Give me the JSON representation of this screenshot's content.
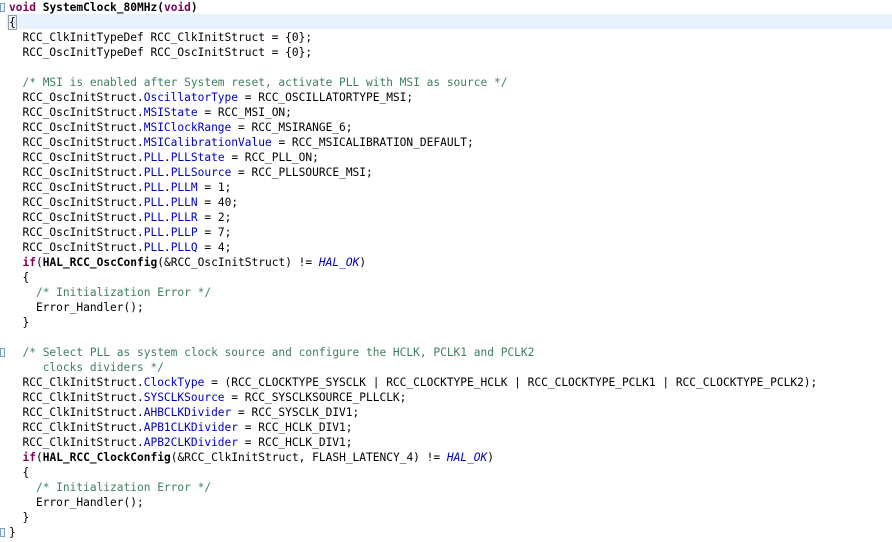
{
  "editor": {
    "lines": [
      {
        "segments": [
          {
            "t": "void",
            "c": "kw"
          },
          {
            "t": " "
          },
          {
            "t": "SystemClock_80MHz",
            "c": "fn"
          },
          {
            "t": "(",
            "c": "fn"
          },
          {
            "t": "void",
            "c": "kw"
          },
          {
            "t": ")",
            "c": "fn"
          }
        ]
      },
      {
        "segments": [
          {
            "t": "{",
            "c": "caret-brace"
          }
        ]
      },
      {
        "segments": [
          {
            "t": "  RCC_ClkInitTypeDef RCC_ClkInitStruct = {0};"
          }
        ]
      },
      {
        "segments": [
          {
            "t": "  RCC_OscInitTypeDef RCC_OscInitStruct = {0};"
          }
        ]
      },
      {
        "segments": [
          {
            "t": ""
          }
        ]
      },
      {
        "segments": [
          {
            "t": "  "
          },
          {
            "t": "/* MSI is enabled after System reset, activate PLL with MSI as source */",
            "c": "cm"
          }
        ]
      },
      {
        "segments": [
          {
            "t": "  RCC_OscInitStruct."
          },
          {
            "t": "OscillatorType",
            "c": "fld"
          },
          {
            "t": " = RCC_OSCILLATORTYPE_MSI;"
          }
        ]
      },
      {
        "segments": [
          {
            "t": "  RCC_OscInitStruct."
          },
          {
            "t": "MSIState",
            "c": "fld"
          },
          {
            "t": " = RCC_MSI_ON;"
          }
        ]
      },
      {
        "segments": [
          {
            "t": "  RCC_OscInitStruct."
          },
          {
            "t": "MSIClockRange",
            "c": "fld"
          },
          {
            "t": " = RCC_MSIRANGE_6;"
          }
        ]
      },
      {
        "segments": [
          {
            "t": "  RCC_OscInitStruct."
          },
          {
            "t": "MSICalibrationValue",
            "c": "fld"
          },
          {
            "t": " = RCC_MSICALIBRATION_DEFAULT;"
          }
        ]
      },
      {
        "segments": [
          {
            "t": "  RCC_OscInitStruct."
          },
          {
            "t": "PLL",
            "c": "fld"
          },
          {
            "t": "."
          },
          {
            "t": "PLLState",
            "c": "fld"
          },
          {
            "t": " = RCC_PLL_ON;"
          }
        ]
      },
      {
        "segments": [
          {
            "t": "  RCC_OscInitStruct."
          },
          {
            "t": "PLL",
            "c": "fld"
          },
          {
            "t": "."
          },
          {
            "t": "PLLSource",
            "c": "fld"
          },
          {
            "t": " = RCC_PLLSOURCE_MSI;"
          }
        ]
      },
      {
        "segments": [
          {
            "t": "  RCC_OscInitStruct."
          },
          {
            "t": "PLL",
            "c": "fld"
          },
          {
            "t": "."
          },
          {
            "t": "PLLM",
            "c": "fld"
          },
          {
            "t": " = 1;"
          }
        ]
      },
      {
        "segments": [
          {
            "t": "  RCC_OscInitStruct."
          },
          {
            "t": "PLL",
            "c": "fld"
          },
          {
            "t": "."
          },
          {
            "t": "PLLN",
            "c": "fld"
          },
          {
            "t": " = 40;"
          }
        ]
      },
      {
        "segments": [
          {
            "t": "  RCC_OscInitStruct."
          },
          {
            "t": "PLL",
            "c": "fld"
          },
          {
            "t": "."
          },
          {
            "t": "PLLR",
            "c": "fld"
          },
          {
            "t": " = 2;"
          }
        ]
      },
      {
        "segments": [
          {
            "t": "  RCC_OscInitStruct."
          },
          {
            "t": "PLL",
            "c": "fld"
          },
          {
            "t": "."
          },
          {
            "t": "PLLP",
            "c": "fld"
          },
          {
            "t": " = 7;"
          }
        ]
      },
      {
        "segments": [
          {
            "t": "  RCC_OscInitStruct."
          },
          {
            "t": "PLL",
            "c": "fld"
          },
          {
            "t": "."
          },
          {
            "t": "PLLQ",
            "c": "fld"
          },
          {
            "t": " = 4;"
          }
        ]
      },
      {
        "segments": [
          {
            "t": "  "
          },
          {
            "t": "if",
            "c": "kw"
          },
          {
            "t": "("
          },
          {
            "t": "HAL_RCC_OscConfig",
            "c": "fn"
          },
          {
            "t": "(&RCC_OscInitStruct) != "
          },
          {
            "t": "HAL_OK",
            "c": "mac"
          },
          {
            "t": ")"
          }
        ]
      },
      {
        "segments": [
          {
            "t": "  {"
          }
        ]
      },
      {
        "segments": [
          {
            "t": "    "
          },
          {
            "t": "/* Initialization Error */",
            "c": "cm"
          }
        ]
      },
      {
        "segments": [
          {
            "t": "    Error_Handler();"
          }
        ]
      },
      {
        "segments": [
          {
            "t": "  }"
          }
        ]
      },
      {
        "segments": [
          {
            "t": ""
          }
        ]
      },
      {
        "segments": [
          {
            "t": "  "
          },
          {
            "t": "/* Select PLL as system clock source and configure the HCLK, PCLK1 and PCLK2",
            "c": "cm"
          }
        ]
      },
      {
        "segments": [
          {
            "t": "     clocks dividers */",
            "c": "cm"
          }
        ]
      },
      {
        "segments": [
          {
            "t": "  RCC_ClkInitStruct."
          },
          {
            "t": "ClockType",
            "c": "fld"
          },
          {
            "t": " = (RCC_CLOCKTYPE_SYSCLK | RCC_CLOCKTYPE_HCLK | RCC_CLOCKTYPE_PCLK1 | RCC_CLOCKTYPE_PCLK2);"
          }
        ]
      },
      {
        "segments": [
          {
            "t": "  RCC_ClkInitStruct."
          },
          {
            "t": "SYSCLKSource",
            "c": "fld"
          },
          {
            "t": " = RCC_SYSCLKSOURCE_PLLCLK;"
          }
        ]
      },
      {
        "segments": [
          {
            "t": "  RCC_ClkInitStruct."
          },
          {
            "t": "AHBCLKDivider",
            "c": "fld"
          },
          {
            "t": " = RCC_SYSCLK_DIV1;"
          }
        ]
      },
      {
        "segments": [
          {
            "t": "  RCC_ClkInitStruct."
          },
          {
            "t": "APB1CLKDivider",
            "c": "fld"
          },
          {
            "t": " = RCC_HCLK_DIV1;"
          }
        ]
      },
      {
        "segments": [
          {
            "t": "  RCC_ClkInitStruct."
          },
          {
            "t": "APB2CLKDivider",
            "c": "fld"
          },
          {
            "t": " = RCC_HCLK_DIV1;"
          }
        ]
      },
      {
        "segments": [
          {
            "t": "  "
          },
          {
            "t": "if",
            "c": "kw"
          },
          {
            "t": "("
          },
          {
            "t": "HAL_RCC_ClockConfig",
            "c": "fn"
          },
          {
            "t": "(&RCC_ClkInitStruct, FLASH_LATENCY_4) != "
          },
          {
            "t": "HAL_OK",
            "c": "mac"
          },
          {
            "t": ")"
          }
        ]
      },
      {
        "segments": [
          {
            "t": "  {"
          }
        ]
      },
      {
        "segments": [
          {
            "t": "    "
          },
          {
            "t": "/* Initialization Error */",
            "c": "cm"
          }
        ]
      },
      {
        "segments": [
          {
            "t": "    Error_Handler();"
          }
        ]
      },
      {
        "segments": [
          {
            "t": "  }"
          }
        ]
      },
      {
        "segments": [
          {
            "t": "}"
          }
        ]
      }
    ],
    "fold_marker_lines": [
      0,
      23,
      35
    ]
  },
  "colors": {
    "keyword": "#7f0055",
    "comment": "#3f7f5f",
    "field": "#0000c0",
    "current_line": "#e8f2fe"
  }
}
